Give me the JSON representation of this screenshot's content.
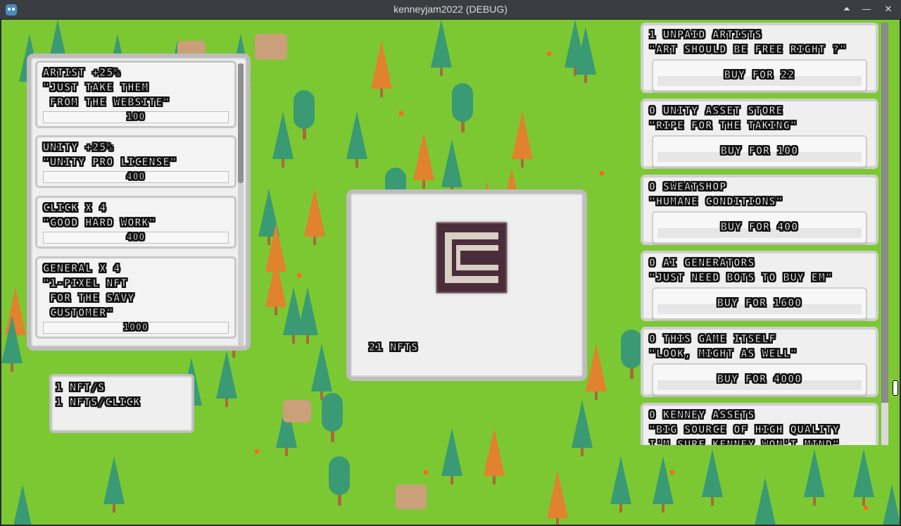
{
  "window": {
    "title": "kenneyjam2022 (DEBUG)"
  },
  "upgrades": [
    {
      "lines": "ARTIST +25%\n\"JUST TAKE THEM\n FROM THE WEBSITE\"",
      "price": "100"
    },
    {
      "lines": "UNITY +25%\n\"UNITY PRO LICENSE\"",
      "price": "400"
    },
    {
      "lines": "CLICK X 4\n\"GOOD HARD WORK\"",
      "price": "400"
    },
    {
      "lines": "GENERAL X 4\n\"1-PIXEL NFT\n FOR THE SAVY\n CUSTOMER\"",
      "price": "1000"
    }
  ],
  "rates": {
    "per_second": "1 NFT/S",
    "per_click": "1 NFTS/CLICK"
  },
  "center": {
    "count": "21 NFTS"
  },
  "generators": [
    {
      "title": "1 UNPAID ARTISTS",
      "quote": "\"ART SHOULD BE FREE RIGHT ?\"",
      "button": "BUY FOR 22"
    },
    {
      "title": "0 UNITY ASSET STORE",
      "quote": "\"RIPE FOR THE TAKING\"",
      "button": "BUY FOR 100"
    },
    {
      "title": "0 SWEATSHOP",
      "quote": "\"HUMANE CONDITIONS\"",
      "button": "BUY FOR 400"
    },
    {
      "title": "0 AI GENERATORS",
      "quote": "\"JUST NEED BOTS TO BUY EM\"",
      "button": "BUY FOR 1600"
    },
    {
      "title": "0 THIS GAME ITSELF",
      "quote": "\"LOOK, MIGHT AS WELL\"",
      "button": "BUY FOR 4000"
    },
    {
      "title": "0 KENNEY ASSETS",
      "quote": "\"BIG SOURCE OF HIGH QUALITY\nI'M SURE KENNEY WON'T MIND\"",
      "button": ""
    }
  ],
  "colors": {
    "grass": "#7cc832",
    "tree_green": "#3a9a74",
    "tree_orange": "#e0822e",
    "panel": "#efefef"
  }
}
